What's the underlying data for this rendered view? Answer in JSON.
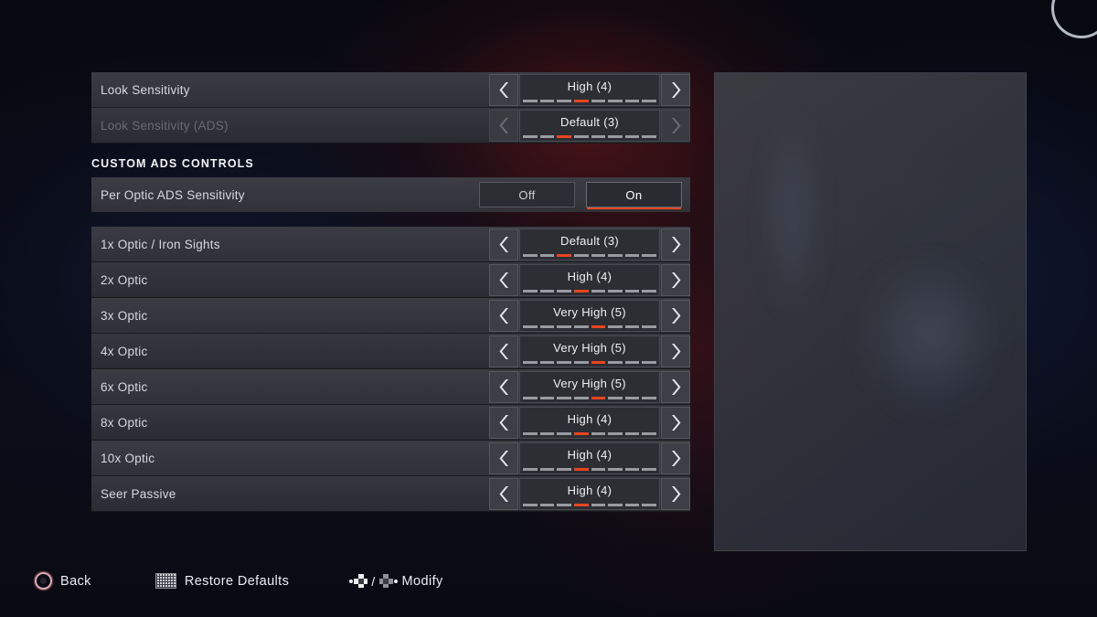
{
  "screen": {
    "accent_color": "#e8451f",
    "panel_color": "#35363d",
    "background_color": "#0a0c16"
  },
  "top_rows": [
    {
      "label": "Look Sensitivity",
      "value": "High (4)",
      "ticks": 8,
      "active_tick": 4,
      "disabled": false,
      "prev_icon": "chevron-left-icon",
      "next_icon": "chevron-right-icon"
    },
    {
      "label": "Look Sensitivity (ADS)",
      "value": "Default (3)",
      "ticks": 8,
      "active_tick": 3,
      "disabled": true,
      "prev_icon": "chevron-left-icon",
      "next_icon": "chevron-right-icon"
    }
  ],
  "section": {
    "title": "CUSTOM ADS CONTROLS",
    "toggle": {
      "label": "Per Optic ADS Sensitivity",
      "options": [
        "Off",
        "On"
      ],
      "selected": "On"
    }
  },
  "optic_rows": [
    {
      "label": "1x Optic / Iron Sights",
      "value": "Default (3)",
      "ticks": 8,
      "active_tick": 3,
      "disabled": false,
      "prev_icon": "chevron-left-icon",
      "next_icon": "chevron-right-icon"
    },
    {
      "label": "2x Optic",
      "value": "High (4)",
      "ticks": 8,
      "active_tick": 4,
      "disabled": false,
      "prev_icon": "chevron-left-icon",
      "next_icon": "chevron-right-icon"
    },
    {
      "label": "3x Optic",
      "value": "Very High (5)",
      "ticks": 8,
      "active_tick": 5,
      "disabled": false,
      "prev_icon": "chevron-left-icon",
      "next_icon": "chevron-right-icon"
    },
    {
      "label": "4x Optic",
      "value": "Very High (5)",
      "ticks": 8,
      "active_tick": 5,
      "disabled": false,
      "prev_icon": "chevron-left-icon",
      "next_icon": "chevron-right-icon"
    },
    {
      "label": "6x Optic",
      "value": "Very High (5)",
      "ticks": 8,
      "active_tick": 5,
      "disabled": false,
      "prev_icon": "chevron-left-icon",
      "next_icon": "chevron-right-icon"
    },
    {
      "label": "8x Optic",
      "value": "High (4)",
      "ticks": 8,
      "active_tick": 4,
      "disabled": false,
      "prev_icon": "chevron-left-icon",
      "next_icon": "chevron-right-icon"
    },
    {
      "label": "10x Optic",
      "value": "High (4)",
      "ticks": 8,
      "active_tick": 4,
      "disabled": false,
      "prev_icon": "chevron-left-icon",
      "next_icon": "chevron-right-icon"
    },
    {
      "label": "Seer Passive",
      "value": "High (4)",
      "ticks": 8,
      "active_tick": 4,
      "disabled": false,
      "prev_icon": "chevron-left-icon",
      "next_icon": "chevron-right-icon"
    }
  ],
  "footer": [
    {
      "label": "Back",
      "icon": "circle-button-icon"
    },
    {
      "label": "Restore Defaults",
      "icon": "touchpad-grid-icon"
    },
    {
      "label": "Modify",
      "icon": "dpad-left-right-icon"
    }
  ]
}
